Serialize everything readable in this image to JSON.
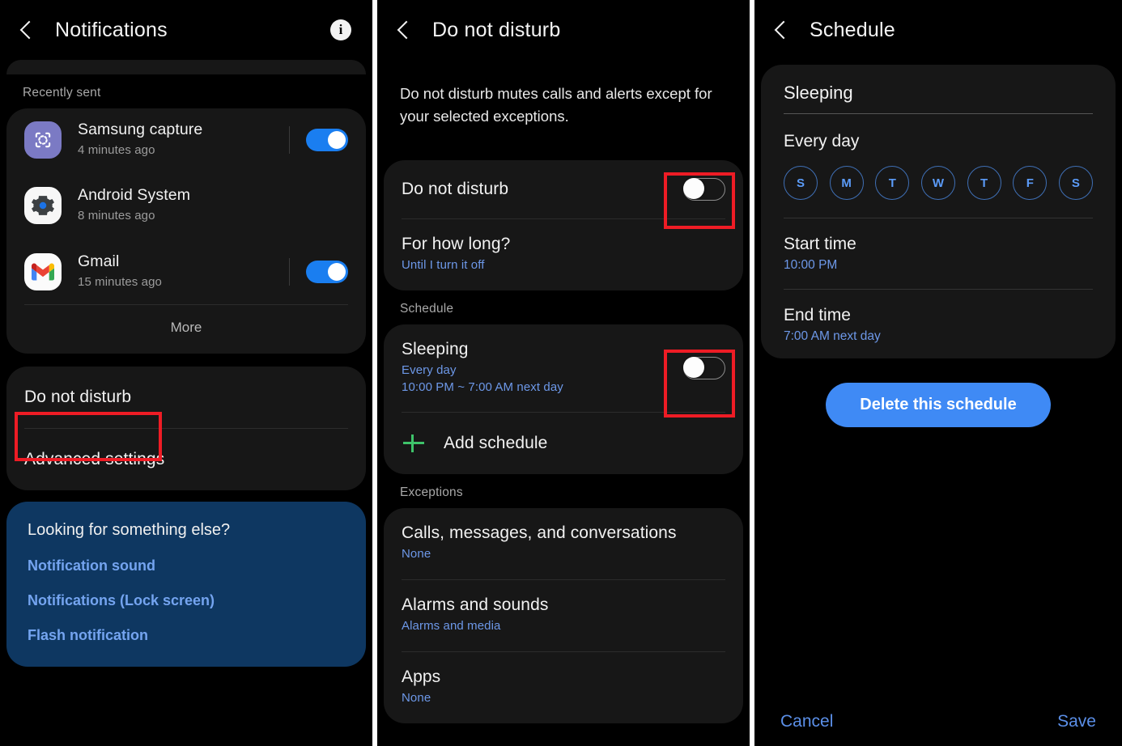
{
  "panel1": {
    "header": {
      "title": "Notifications",
      "back_icon": "chevron-left-icon",
      "info_icon": "info-circle-icon"
    },
    "recently_sent_label": "Recently sent",
    "apps": [
      {
        "name": "Samsung capture",
        "time": "4 minutes ago",
        "icon": "samsung-capture-icon",
        "toggle": "on"
      },
      {
        "name": "Android System",
        "time": "8 minutes ago",
        "icon": "android-system-gear-icon",
        "toggle": "none"
      },
      {
        "name": "Gmail",
        "time": "15 minutes ago",
        "icon": "gmail-icon",
        "toggle": "on"
      }
    ],
    "more_label": "More",
    "settings": [
      {
        "label": "Do not disturb",
        "highlighted": true
      },
      {
        "label": "Advanced settings",
        "highlighted": false
      }
    ],
    "promo": {
      "heading": "Looking for something else?",
      "links": [
        "Notification sound",
        "Notifications (Lock screen)",
        "Flash notification"
      ]
    }
  },
  "panel2": {
    "header": {
      "title": "Do not disturb",
      "back_icon": "chevron-left-icon"
    },
    "description": "Do not disturb mutes calls and alerts except for your selected exceptions.",
    "dnd_row": {
      "title": "Do not disturb",
      "toggle": "off",
      "highlighted": true
    },
    "duration_row": {
      "title": "For how long?",
      "value": "Until I turn it off"
    },
    "schedule_label": "Schedule",
    "sleeping_row": {
      "title": "Sleeping",
      "sub1": "Every day",
      "sub2": "10:00 PM ~ 7:00 AM next day",
      "toggle": "off",
      "highlighted": true
    },
    "add_schedule": {
      "label": "Add schedule",
      "icon": "plus-icon"
    },
    "exceptions_label": "Exceptions",
    "exceptions": [
      {
        "title": "Calls, messages, and conversations",
        "value": "None"
      },
      {
        "title": "Alarms and sounds",
        "value": "Alarms and media"
      },
      {
        "title": "Apps",
        "value": "None"
      }
    ]
  },
  "panel3": {
    "header": {
      "title": "Schedule",
      "back_icon": "chevron-left-icon"
    },
    "name_value": "Sleeping",
    "repeat_label": "Every day",
    "days": [
      {
        "letter": "S",
        "selected": true
      },
      {
        "letter": "M",
        "selected": true
      },
      {
        "letter": "T",
        "selected": true
      },
      {
        "letter": "W",
        "selected": true
      },
      {
        "letter": "T",
        "selected": true
      },
      {
        "letter": "F",
        "selected": true
      },
      {
        "letter": "S",
        "selected": true
      }
    ],
    "start_time": {
      "label": "Start time",
      "value": "10:00 PM"
    },
    "end_time": {
      "label": "End time",
      "value": "7:00 AM next day"
    },
    "delete_button": "Delete this schedule",
    "cancel_button": "Cancel",
    "save_button": "Save"
  },
  "colors": {
    "accent_blue": "#3f8af5",
    "link_blue": "#6d98e8",
    "toggle_on": "#1a7ef0",
    "highlight_red": "#ee1c25",
    "card_bg": "#171717",
    "promo_bg": "#0e3761",
    "plus_green": "#3ec36a"
  }
}
